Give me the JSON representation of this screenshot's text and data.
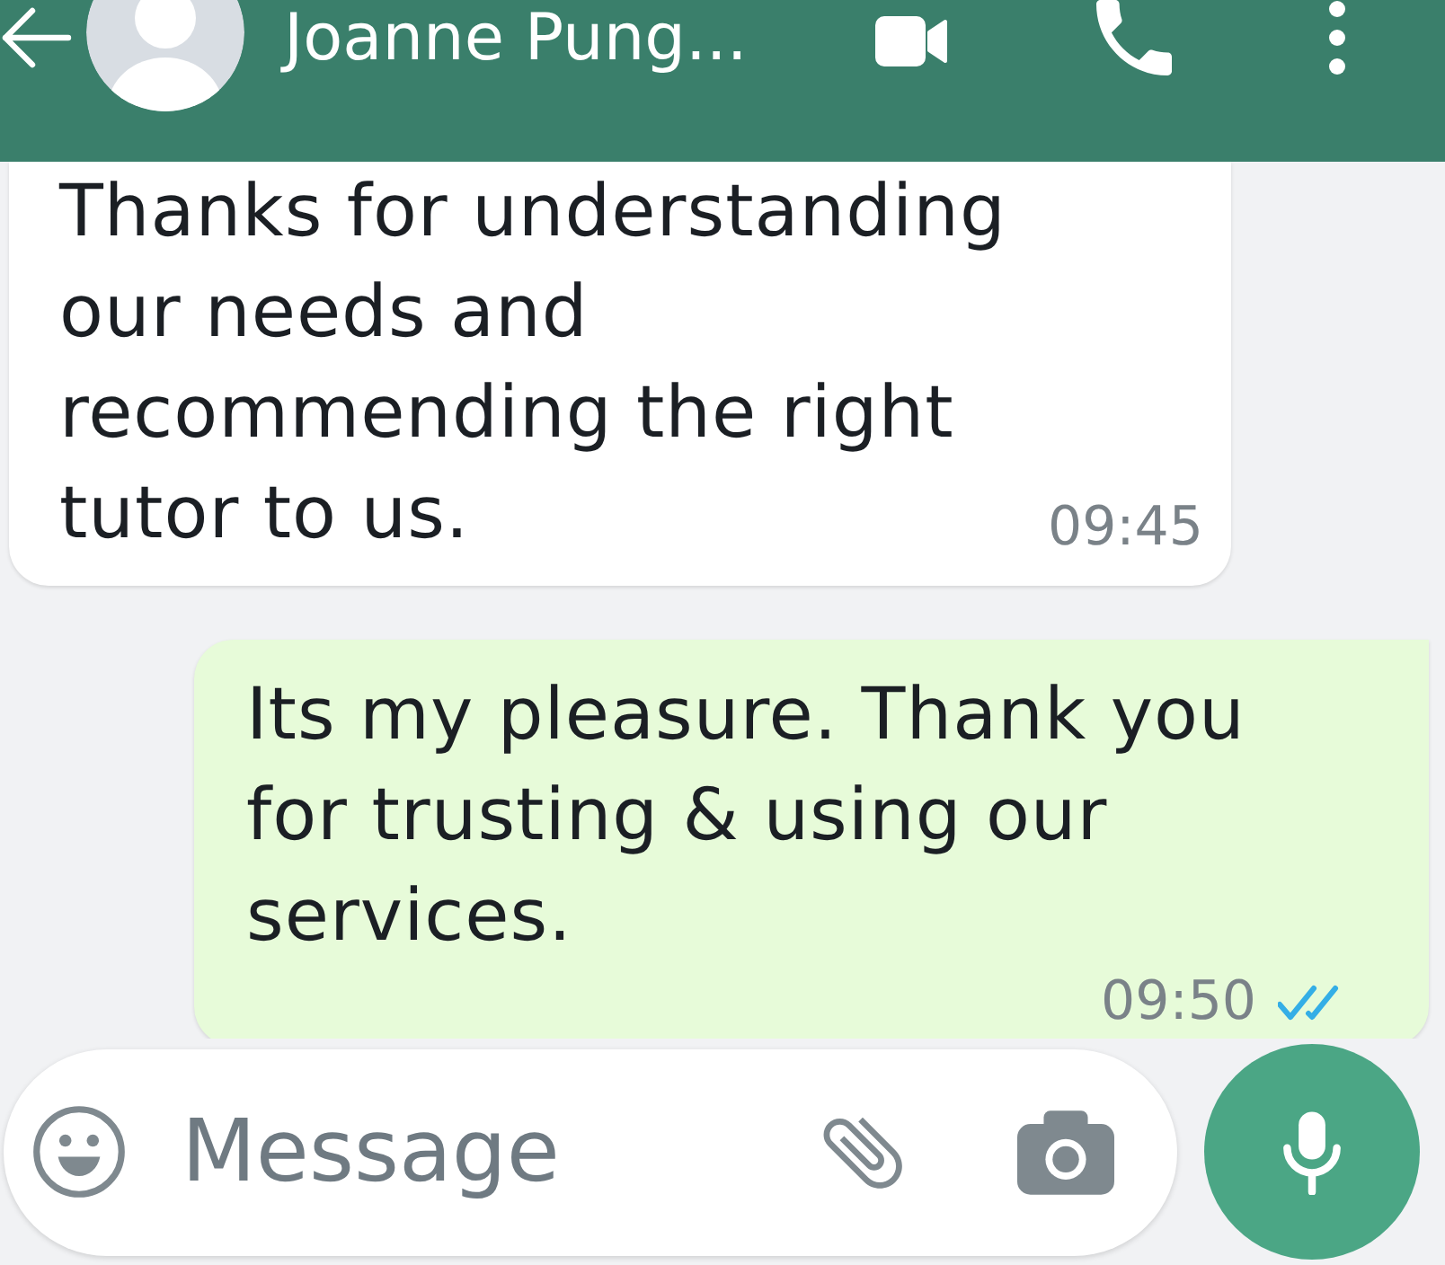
{
  "header": {
    "contact_name": "Joanne Pung..."
  },
  "messages": [
    {
      "kind": "received",
      "text": "Thanks for understanding our needs and recommending the right tutor to us.",
      "time": "09:45"
    },
    {
      "kind": "sent",
      "text": "Its my pleasure. Thank you for trusting & using our services.",
      "time": "09:50",
      "read": true
    }
  ],
  "composer": {
    "placeholder": "Message"
  }
}
